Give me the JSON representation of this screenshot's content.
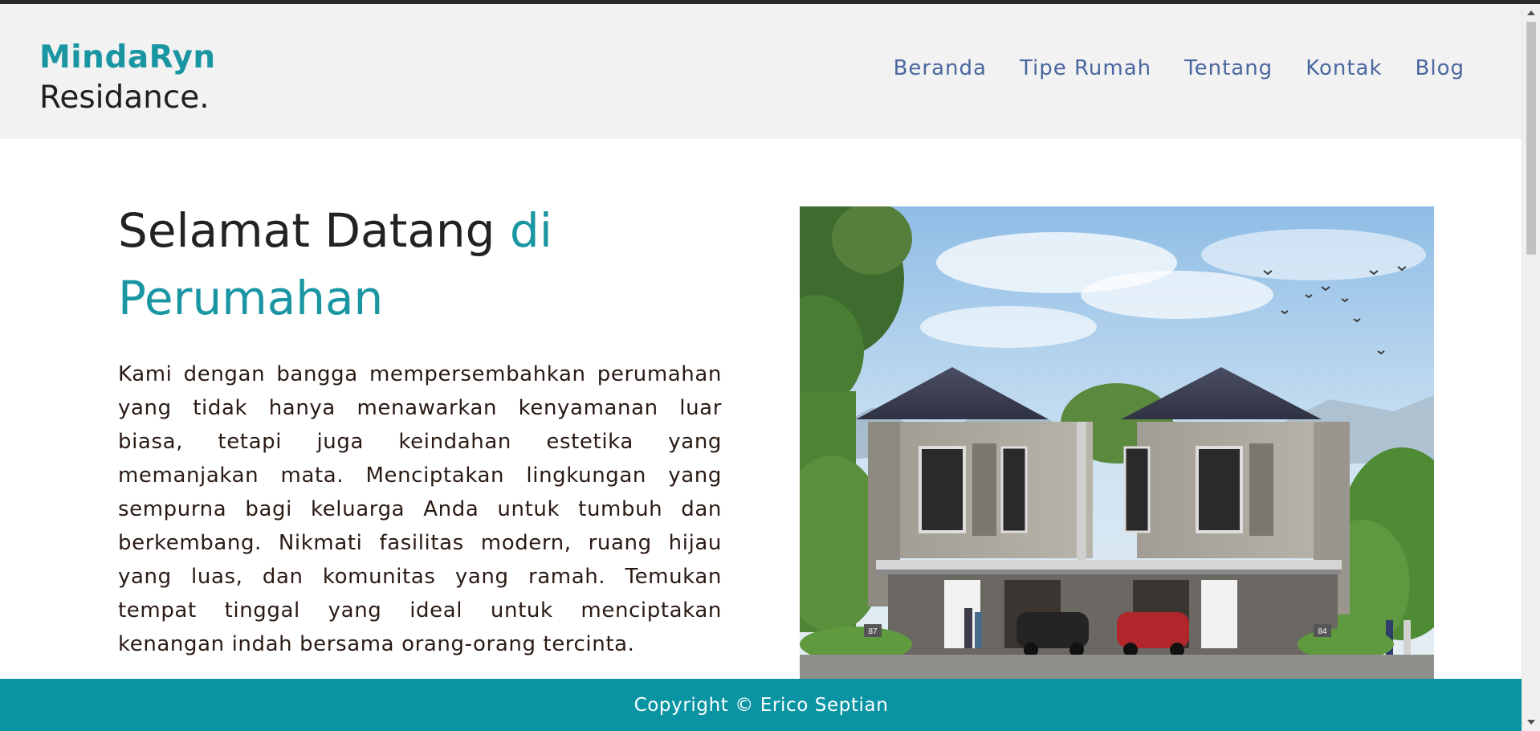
{
  "header": {
    "brand_name": "MindaRyn",
    "brand_sub": "Residance."
  },
  "nav": {
    "items": [
      {
        "label": "Beranda"
      },
      {
        "label": "Tipe Rumah"
      },
      {
        "label": "Tentang"
      },
      {
        "label": "Kontak"
      },
      {
        "label": "Blog"
      }
    ]
  },
  "hero": {
    "title_main": "Selamat Datang",
    "title_accent": "di Perumahan",
    "description": "Kami dengan bangga mempersembahkan perumahan yang tidak hanya menawarkan kenyamanan luar biasa, tetapi juga keindahan estetika yang memanjakan mata. Menciptakan lingkungan yang sempurna bagi keluarga Anda untuk tumbuh dan berkembang. Nikmati fasilitas modern, ruang hijau yang luas, dan komunitas yang ramah. Temukan tempat tinggal yang ideal untuk menciptakan kenangan indah bersama orang-orang tercinta.",
    "image_numbers": [
      "87",
      "84"
    ]
  },
  "footer": {
    "copyright": "Copyright © Erico Septian"
  },
  "colors": {
    "accent": "#1a96a3",
    "footer": "#0a94a3",
    "nav_link": "#4a67a0",
    "header_bg": "#f2f2f2"
  }
}
